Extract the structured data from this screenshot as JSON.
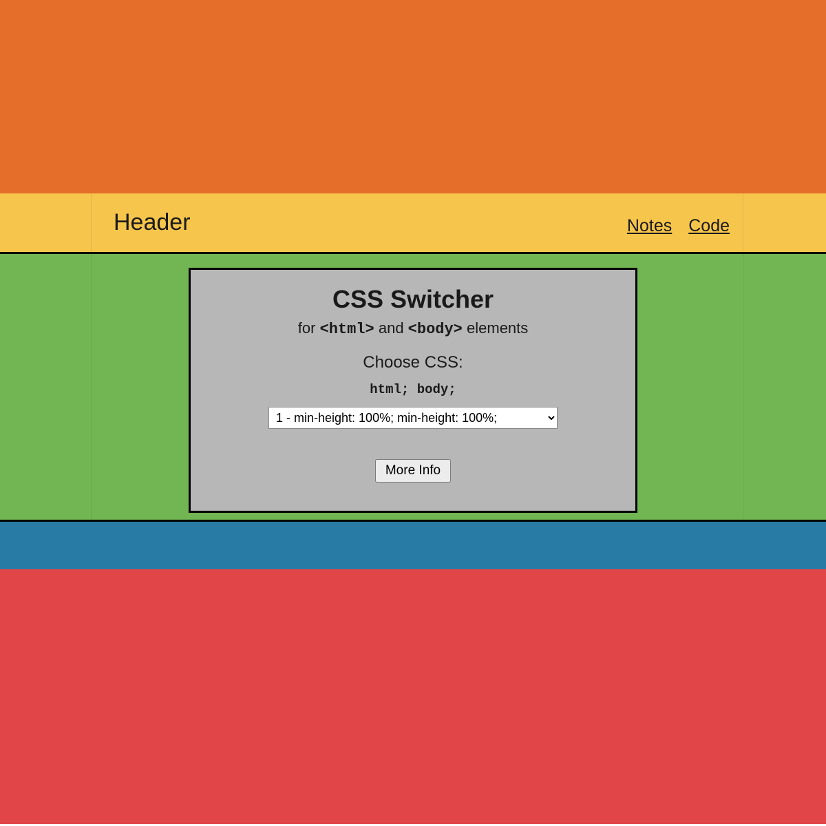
{
  "header": {
    "title": "Header",
    "nav": [
      {
        "label": "Notes"
      },
      {
        "label": "Code"
      }
    ]
  },
  "switcher": {
    "title": "CSS Switcher",
    "subtitle_prefix": "for ",
    "subtitle_code1": "<html>",
    "subtitle_mid": " and ",
    "subtitle_code2": "<body>",
    "subtitle_suffix": " elements",
    "choose_label": "Choose CSS:",
    "code_label": "html; body;",
    "selected_option": "1 - min-height: 100%; min-height: 100%;",
    "more_info": "More Info"
  },
  "colors": {
    "orange": "#E56E2B",
    "yellow": "#F6C54B",
    "green": "#72B653",
    "blue": "#287BA4",
    "red": "#E14548",
    "gray": "#B7B7B7"
  }
}
